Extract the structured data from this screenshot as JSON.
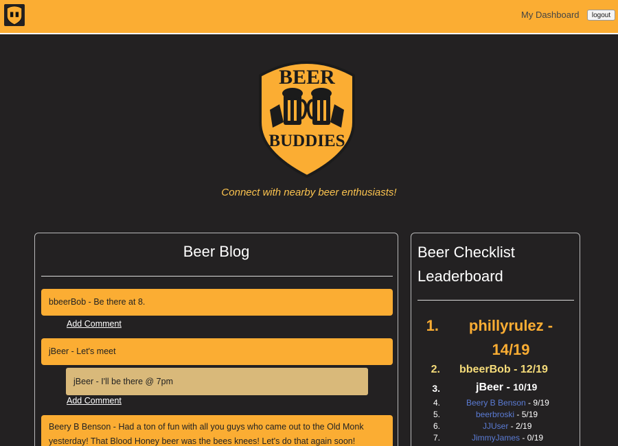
{
  "nav": {
    "dashboard_label": "My Dashboard",
    "logout_label": "logout",
    "logo_text_top": "BEER",
    "logo_text_bottom": "BUDDIES"
  },
  "hero": {
    "logo_text_top": "BEER",
    "logo_text_bottom": "BUDDIES",
    "tagline": "Connect with nearby beer enthusiasts!"
  },
  "blog": {
    "title": "Beer Blog",
    "add_comment_label": "Add Comment",
    "posts": [
      {
        "text": "bbeerBob - Be there at 8."
      },
      {
        "text": "jBeer - Let's meet",
        "reply": "jBeer - I'll be there @ 7pm"
      },
      {
        "text": "Beery B Benson - Had a ton of fun with all you guys who came out to the Old Monk yesterday! That Blood Honey beer was the bees knees! Let's do that again soon!"
      }
    ]
  },
  "leaderboard": {
    "title": "Beer Checklist Leaderboard",
    "entries": [
      {
        "rank": "1.",
        "name": "phillyrulez",
        "score": "14/19"
      },
      {
        "rank": "2.",
        "name": "bbeerBob",
        "score": "12/19"
      },
      {
        "rank": "3.",
        "name": "jBeer",
        "score": "10/19"
      },
      {
        "rank": "4.",
        "name": "Beery B Benson",
        "score": "9/19"
      },
      {
        "rank": "5.",
        "name": "beerbroski",
        "score": "5/19"
      },
      {
        "rank": "6.",
        "name": "JJUser",
        "score": "2/19"
      },
      {
        "rank": "7.",
        "name": "JimmyJames",
        "score": "0/19"
      }
    ]
  },
  "colors": {
    "accent": "#fbad33",
    "background": "#232122",
    "reply": "#d9b97a",
    "link": "#5b7cd6"
  }
}
